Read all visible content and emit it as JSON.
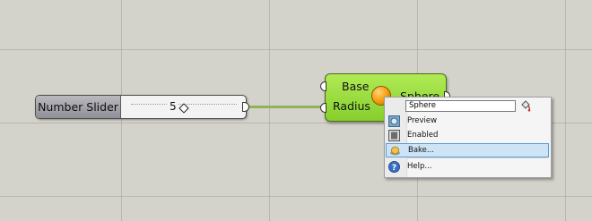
{
  "slider": {
    "label": "Number Slider",
    "value": "5"
  },
  "component": {
    "inputs": [
      "Base",
      "Radius"
    ],
    "output": "Sphere"
  },
  "context_menu": {
    "name_value": "Sphere",
    "items": [
      {
        "label": "Preview",
        "icon": "preview-icon"
      },
      {
        "label": "Enabled",
        "icon": "enabled-icon"
      },
      {
        "label": "Bake...",
        "icon": "bake-icon",
        "highlighted": true
      },
      {
        "label": "Help...",
        "icon": "help-icon"
      }
    ]
  },
  "colors": {
    "canvas": "#d4d3cb",
    "component_fill": "#9ddc40",
    "wire": "#8fb457",
    "menu_highlight": "#cde4f7"
  }
}
